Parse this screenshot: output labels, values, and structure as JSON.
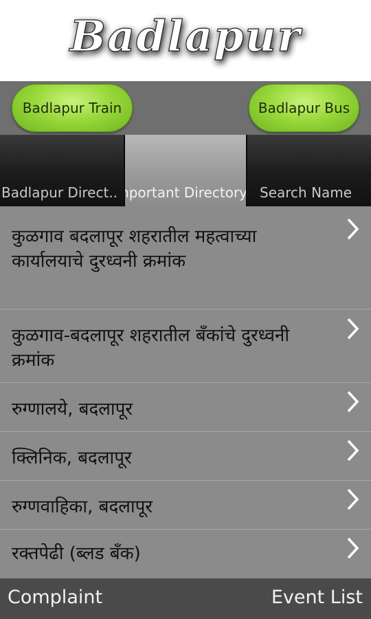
{
  "header": {
    "title": "Badlapur"
  },
  "buttons": {
    "train": "Badlapur Train",
    "bus": "Badlapur Bus"
  },
  "tabs": [
    {
      "label": "Badlapur Direct..",
      "active": false
    },
    {
      "label": "Important Directory",
      "active": true
    },
    {
      "label": "Search Name",
      "active": false
    }
  ],
  "list": [
    {
      "label": "कुळगाव बदलापूर शहरातील महत्वाच्या कार्यालयाचे दुरध्वनी क्रमांक"
    },
    {
      "label": "कुळगाव-बदलापूर शहरातील बँकांचे दुरध्वनी क्रमांक"
    },
    {
      "label": "रुग्णालये, बदलापूर"
    },
    {
      "label": "क्लिनिक, बदलापूर"
    },
    {
      "label": "रुग्णवाहिका, बदलापूर"
    },
    {
      "label": "रक्तपेढी (ब्लड बँक)"
    }
  ],
  "footer": {
    "left": "Complaint",
    "right": "Event List"
  },
  "colors": {
    "green_button": "#9ad93c",
    "list_bg": "#8b8b8b",
    "footer_bg": "#4a4a4a"
  },
  "icons": {
    "list_chevron": "chevron-right-icon"
  }
}
